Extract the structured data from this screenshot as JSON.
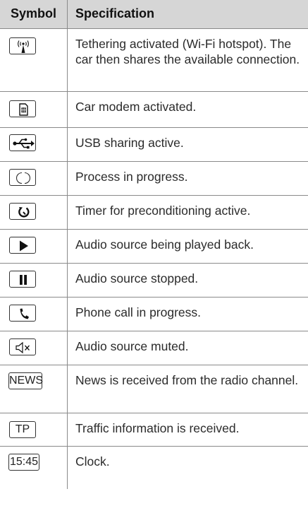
{
  "table": {
    "header": {
      "symbol": "Symbol",
      "specification": "Specification"
    },
    "rows": [
      {
        "icon": "wifi-hotspot-icon",
        "text": "Tethering activated (Wi-Fi hotspot). The car then shares the available connection."
      },
      {
        "icon": "car-modem-sim-icon",
        "text": "Car modem activated."
      },
      {
        "icon": "usb-icon",
        "text": "USB sharing active."
      },
      {
        "icon": "process-circle-icon",
        "text": "Process in progress."
      },
      {
        "icon": "timer-icon",
        "text": "Timer for preconditioning active."
      },
      {
        "icon": "play-icon",
        "text": "Audio source being played back."
      },
      {
        "icon": "pause-icon",
        "text": "Audio source stopped."
      },
      {
        "icon": "phone-icon",
        "text": "Phone call in progress."
      },
      {
        "icon": "speaker-muted-icon",
        "text": "Audio source muted."
      },
      {
        "icon": "news-badge",
        "label": "NEWS",
        "text": "News is received from the radio channel."
      },
      {
        "icon": "tp-badge",
        "label": "TP",
        "text": "Traffic information is received."
      },
      {
        "icon": "clock-badge",
        "label": "15:45",
        "text": "Clock."
      }
    ]
  }
}
